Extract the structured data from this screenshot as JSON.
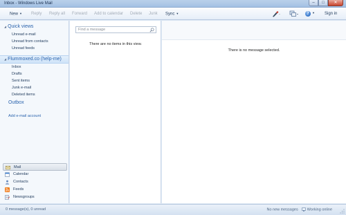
{
  "window": {
    "title": "Inbox - Windows Live Mail"
  },
  "toolbar": {
    "new_label": "New",
    "reply_label": "Reply",
    "reply_all_label": "Reply all",
    "forward_label": "Forward",
    "add_to_calendar_label": "Add to calendar",
    "delete_label": "Delete",
    "junk_label": "Junk",
    "sync_label": "Sync",
    "sign_in_label": "Sign in",
    "icons": [
      "pen-icon",
      "views-icon",
      "help-icon"
    ]
  },
  "navpane": {
    "quick_views": {
      "label": "Quick views",
      "items": [
        "Unread e-mail",
        "Unread from contacts",
        "Unread feeds"
      ]
    },
    "account": {
      "label": "Flummoxed.co (help-me)",
      "items": [
        "Inbox",
        "Drafts",
        "Sent items",
        "Junk e-mail",
        "Deleted items"
      ]
    },
    "outbox_label": "Outbox",
    "add_account_label": "Add e-mail account",
    "bottom": [
      {
        "label": "Mail",
        "icon": "mail-icon"
      },
      {
        "label": "Calendar",
        "icon": "calendar-icon"
      },
      {
        "label": "Contacts",
        "icon": "contacts-icon"
      },
      {
        "label": "Feeds",
        "icon": "feeds-icon"
      },
      {
        "label": "Newsgroups",
        "icon": "newsgroups-icon"
      }
    ]
  },
  "listpane": {
    "search_placeholder": "Find a message",
    "empty_text": "There are no items in this view."
  },
  "readpane": {
    "empty_text": "There is no message selected."
  },
  "statusbar": {
    "left_text": "0 message(s), 0 unread",
    "new_messages_text": "No new messages",
    "online_text": "Working online"
  },
  "colors": {
    "accent": "#2a63ad",
    "frame": "#dfe9f5",
    "disabled_text": "#a3acb8"
  }
}
